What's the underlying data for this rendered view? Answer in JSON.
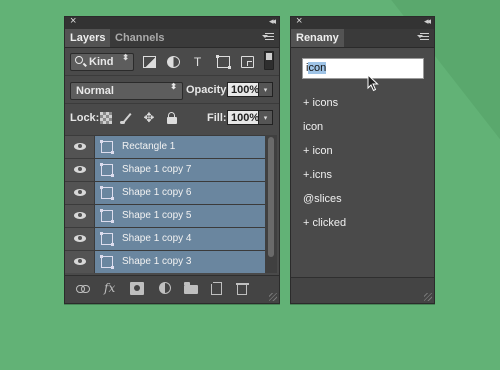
{
  "layers_panel": {
    "close_glyph": "×",
    "collapse_glyph": "◂◂",
    "tabs": [
      "Layers",
      "Channels"
    ],
    "filter": {
      "label": "Kind",
      "arrow": "⬍",
      "type_icon": "T"
    },
    "blend_mode": "Normal",
    "opacity_label": "Opacity:",
    "opacity_value": "100%",
    "lock_label": "Lock:",
    "move_glyph": "✥",
    "fill_label": "Fill:",
    "fill_value": "100%",
    "dropdown_glyph": "▾",
    "layers": [
      "Rectangle 1",
      "Shape 1 copy 7",
      "Shape 1 copy 6",
      "Shape 1 copy 5",
      "Shape 1 copy 4",
      "Shape 1 copy 3"
    ],
    "fx_label": "fx"
  },
  "renamy_panel": {
    "close_glyph": "×",
    "collapse_glyph": "◂◂",
    "tab": "Renamy",
    "input_prefix": "i",
    "input_selected": "con",
    "items": [
      "+ icons",
      "icon",
      "+ icon",
      "+.icns",
      "@slices",
      "+ clicked"
    ]
  },
  "colors": {
    "background": "#62b276",
    "panel": "#4a4a4a",
    "selection": "#6a869f"
  }
}
